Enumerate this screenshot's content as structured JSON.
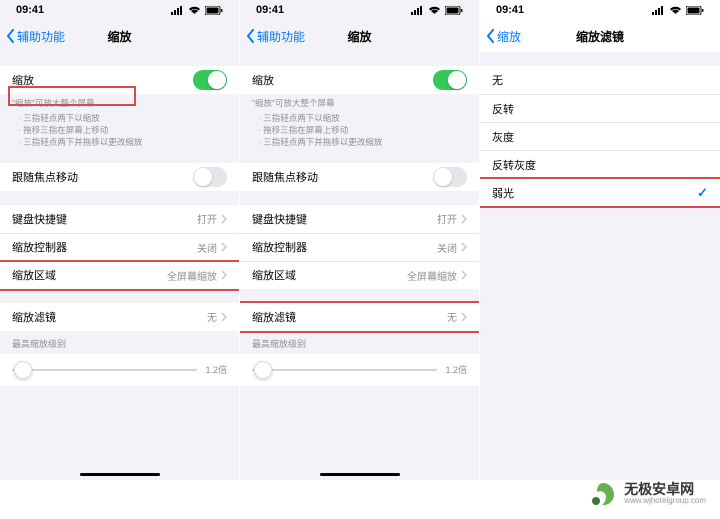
{
  "status": {
    "time": "09:41"
  },
  "phones": [
    {
      "back": "辅助功能",
      "title": "缩放",
      "zoomToggle": {
        "label": "缩放",
        "on": true
      },
      "hintTitle": "\"缩放\"可放大整个屏幕",
      "hints": [
        "三指轻点两下以缩放",
        "拖移三指在屏幕上移动",
        "三指轻点两下并拖移以更改缩放"
      ],
      "followFocus": {
        "label": "跟随焦点移动",
        "on": false
      },
      "rows": [
        {
          "label": "键盘快捷键",
          "value": "打开"
        },
        {
          "label": "缩放控制器",
          "value": "关闭"
        },
        {
          "label": "缩放区域",
          "value": "全屏幕缩放"
        }
      ],
      "filter": {
        "label": "缩放滤镜",
        "value": "无"
      },
      "maxLabel": "最高缩放级别",
      "maxValue": "1.2倍",
      "highlights": [
        "hint-first",
        "zoom-area"
      ]
    },
    {
      "back": "辅助功能",
      "title": "缩放",
      "zoomToggle": {
        "label": "缩放",
        "on": true
      },
      "hintTitle": "\"缩放\"可放大整个屏幕",
      "hints": [
        "三指轻点两下以缩放",
        "拖移三指在屏幕上移动",
        "三指轻点两下并拖移以更改缩放"
      ],
      "followFocus": {
        "label": "跟随焦点移动",
        "on": false
      },
      "rows": [
        {
          "label": "键盘快捷键",
          "value": "打开"
        },
        {
          "label": "缩放控制器",
          "value": "关闭"
        },
        {
          "label": "缩放区域",
          "value": "全屏幕缩放"
        }
      ],
      "filter": {
        "label": "缩放滤镜",
        "value": "无"
      },
      "maxLabel": "最高缩放级别",
      "maxValue": "1.2倍",
      "highlights": [
        "zoom-filter"
      ]
    },
    {
      "back": "缩放",
      "title": "缩放滤镜",
      "options": [
        {
          "label": "无",
          "checked": false
        },
        {
          "label": "反转",
          "checked": false
        },
        {
          "label": "灰度",
          "checked": false
        },
        {
          "label": "反转灰度",
          "checked": false
        },
        {
          "label": "弱光",
          "checked": true
        }
      ],
      "highlights": [
        "weak-light"
      ]
    }
  ],
  "watermark": {
    "cn": "无极安卓网",
    "url": "www.wjhotelgroup.com"
  }
}
